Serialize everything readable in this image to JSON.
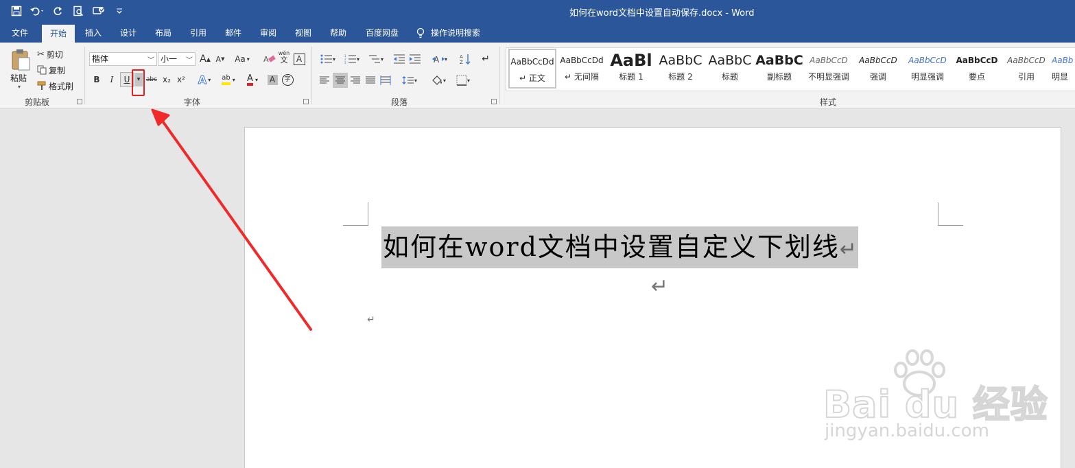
{
  "window": {
    "title": "如何在word文档中设置自动保存.docx  -  Word"
  },
  "quick_access": [
    "save-icon",
    "undo-icon",
    "redo-icon",
    "print-preview-icon",
    "touch-mode-icon",
    "customize-icon"
  ],
  "tabs": [
    "文件",
    "开始",
    "插入",
    "设计",
    "布局",
    "引用",
    "邮件",
    "审阅",
    "视图",
    "帮助",
    "百度网盘",
    "操作说明搜索"
  ],
  "active_tab": "开始",
  "clipboard": {
    "paste": "粘贴",
    "cut": "剪切",
    "copy": "复制",
    "format_painter": "格式刷",
    "group_label": "剪贴板"
  },
  "font": {
    "family": "楷体",
    "size": "小一",
    "grow": "A",
    "shrink": "A",
    "case": "Aa",
    "phonetic": "wén",
    "bold": "B",
    "italic": "I",
    "underline": "U",
    "strike": "abc",
    "subscript": "x₂",
    "superscript": "x²",
    "text_effects": "A",
    "highlight": "ab",
    "font_color": "A",
    "char_shading": "A",
    "enclose": "字",
    "group_label": "字体"
  },
  "paragraph": {
    "group_label": "段落"
  },
  "styles": {
    "group_label": "样式",
    "items": [
      {
        "preview": "AaBbCcDd",
        "name": "正文",
        "selected": true
      },
      {
        "preview": "AaBbCcDd",
        "name": "无间隔"
      },
      {
        "preview": "AaBl",
        "name": "标题 1"
      },
      {
        "preview": "AaBbC",
        "name": "标题 2"
      },
      {
        "preview": "AaBbC",
        "name": "标题"
      },
      {
        "preview": "AaBbC",
        "name": "副标题"
      },
      {
        "preview": "AaBbCcD",
        "name": "不明显强调"
      },
      {
        "preview": "AaBbCcD",
        "name": "强调"
      },
      {
        "preview": "AaBbCcD",
        "name": "明显强调"
      },
      {
        "preview": "AaBbCcD",
        "name": "要点"
      },
      {
        "preview": "AaBbCcD",
        "name": "引用"
      },
      {
        "preview": "AaBb",
        "name": "明显"
      }
    ]
  },
  "document": {
    "title_text": "如何在word文档中设置自定义下划线",
    "paragraph_mark": "↵"
  },
  "watermark": {
    "brand": "Bai du 经验",
    "url": "jingyan.baidu.com"
  },
  "colors": {
    "accent": "#2b579a",
    "highlight_red": "#e02020",
    "arrow_red": "#f02a2a"
  }
}
